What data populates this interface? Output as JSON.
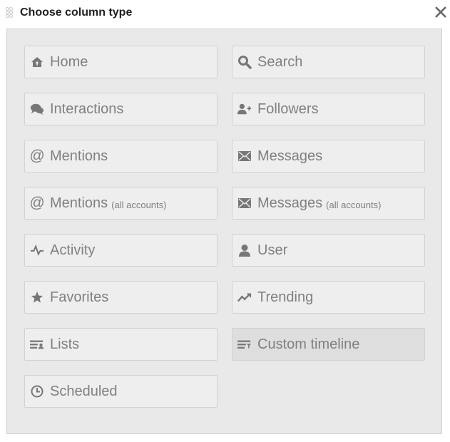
{
  "dialog": {
    "title": "Choose column type",
    "close_icon": "close-icon"
  },
  "column_types": {
    "home": {
      "label": "Home",
      "icon": "home-icon"
    },
    "search": {
      "label": "Search",
      "icon": "search-icon"
    },
    "interactions": {
      "label": "Interactions",
      "icon": "speech-bubbles-icon"
    },
    "followers": {
      "label": "Followers",
      "icon": "user-plus-icon"
    },
    "mentions": {
      "label": "Mentions",
      "icon": "at-icon"
    },
    "messages": {
      "label": "Messages",
      "icon": "envelope-icon"
    },
    "mentions_all": {
      "label": "Mentions",
      "sub": "(all accounts)",
      "icon": "at-icon"
    },
    "messages_all": {
      "label": "Messages",
      "sub": "(all accounts)",
      "icon": "envelope-icon"
    },
    "activity": {
      "label": "Activity",
      "icon": "pulse-icon"
    },
    "user": {
      "label": "User",
      "icon": "user-icon"
    },
    "favorites": {
      "label": "Favorites",
      "icon": "star-icon"
    },
    "trending": {
      "label": "Trending",
      "icon": "trending-icon"
    },
    "lists": {
      "label": "Lists",
      "icon": "list-icon"
    },
    "custom_timeline": {
      "label": "Custom timeline",
      "icon": "custom-timeline-icon",
      "state": "hovered"
    },
    "scheduled": {
      "label": "Scheduled",
      "icon": "clock-icon"
    }
  }
}
